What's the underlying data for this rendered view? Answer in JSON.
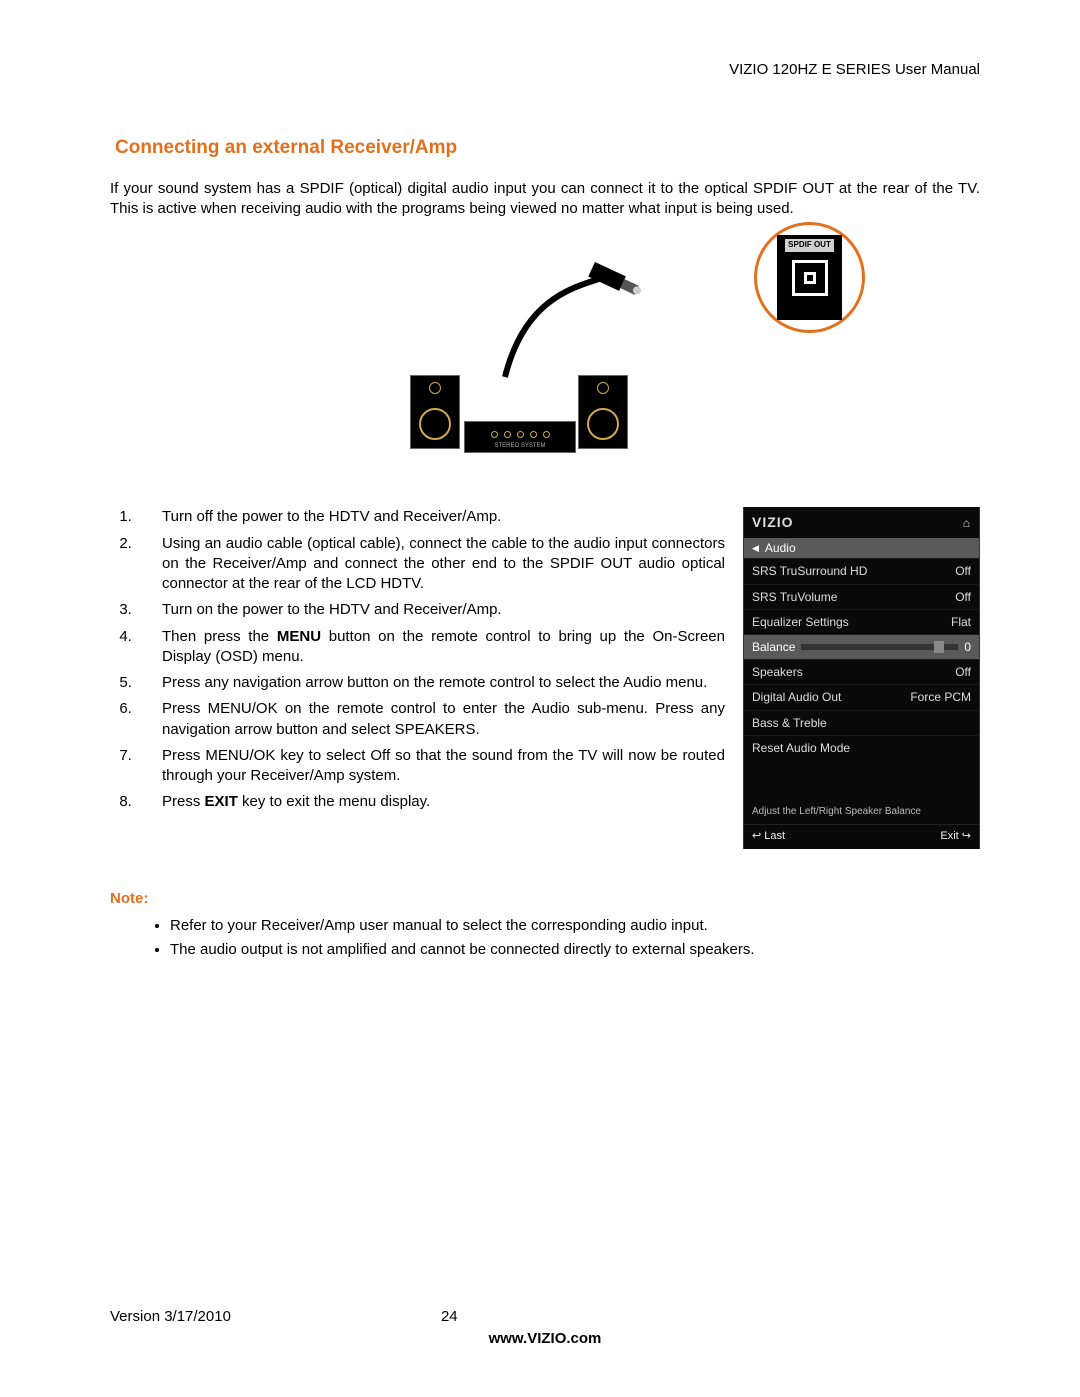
{
  "header": "VIZIO 120HZ E SERIES User Manual",
  "title": "Connecting an external Receiver/Amp",
  "intro": "If your sound system has a SPDIF (optical) digital audio input you can connect it to the optical  SPDIF OUT at the rear of the TV.  This is active when receiving audio with the programs being viewed no matter what input is being used.",
  "spdif_label": "SPDIF OUT",
  "amp_label": "STEREO SYSTEM",
  "steps": [
    {
      "pre": "Turn off the power to the HDTV and Receiver/Amp.",
      "bold": "",
      "post": ""
    },
    {
      "pre": "Using an audio cable (optical cable), connect the cable to the audio input connectors on the Receiver/Amp and connect the other end to the SPDIF OUT  audio optical connector at the rear of the LCD HDTV.",
      "bold": "",
      "post": ""
    },
    {
      "pre": "Turn on the power to the HDTV and Receiver/Amp.",
      "bold": "",
      "post": ""
    },
    {
      "pre": "Then press the ",
      "bold": "MENU",
      "post": " button on the remote control to bring up the On-Screen Display (OSD) menu."
    },
    {
      "pre": "Press any navigation arrow button on the remote control to select the Audio menu.",
      "bold": "",
      "post": ""
    },
    {
      "pre": "Press MENU/OK on the remote control to enter the Audio sub-menu. Press any navigation arrow button and select SPEAKERS.",
      "bold": "",
      "post": ""
    },
    {
      "pre": "Press MENU/OK key to select Off so that the sound from the TV will now be routed through your Receiver/Amp system.",
      "bold": "",
      "post": ""
    },
    {
      "pre": "Press ",
      "bold": "EXIT",
      "post": " key to exit the menu display."
    }
  ],
  "osd": {
    "logo": "VIZIO",
    "menu_label": "Audio",
    "rows": [
      {
        "label": "SRS TruSurround HD",
        "value": "Off"
      },
      {
        "label": "SRS TruVolume",
        "value": "Off"
      },
      {
        "label": "Equalizer Settings",
        "value": "Flat"
      },
      {
        "label": "Balance",
        "value": "0",
        "slider": true,
        "highlight": true
      },
      {
        "label": "Speakers",
        "value": "Off"
      },
      {
        "label": "Digital Audio Out",
        "value": "Force PCM"
      },
      {
        "label": "Bass & Treble",
        "value": ""
      },
      {
        "label": "Reset Audio Mode",
        "value": ""
      }
    ],
    "hint": "Adjust the Left/Right Speaker Balance",
    "last": "Last",
    "exit": "Exit"
  },
  "note_heading": "Note:",
  "notes": [
    "Refer to your Receiver/Amp user manual to select the corresponding audio input.",
    "The audio output is not amplified and cannot be connected directly to external speakers."
  ],
  "footer": {
    "version": "Version 3/17/2010",
    "page": "24",
    "site": "www.VIZIO.com"
  }
}
